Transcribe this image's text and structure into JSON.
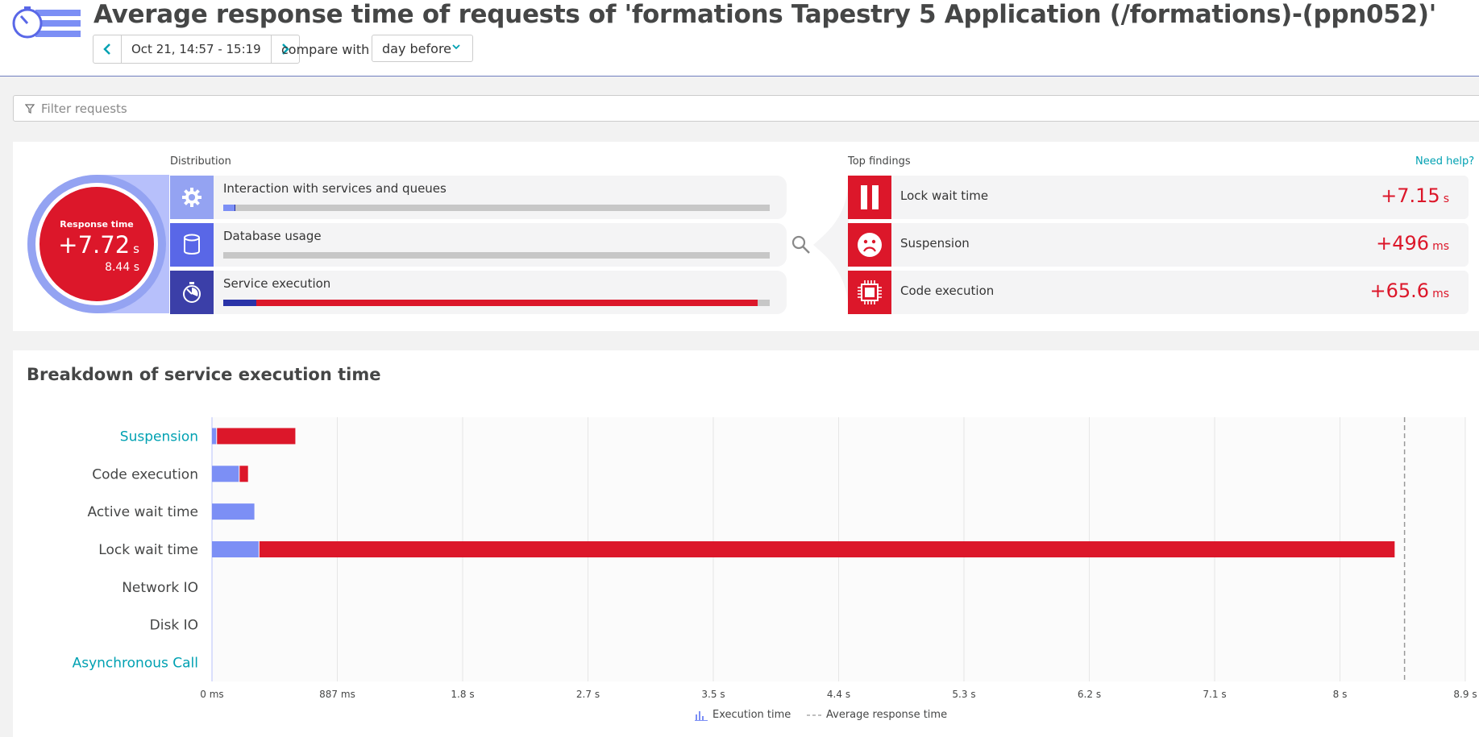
{
  "header": {
    "title": "Average response time of requests of 'formations Tapestry 5 Application (/formations)-(ppn052)'",
    "timeframe": "Oct 21, 14:57 - 15:19",
    "compare_label": "compare with",
    "compare_value": "day before",
    "prev_icon": "chevron-left-icon",
    "next_icon": "chevron-right-icon"
  },
  "filter": {
    "placeholder": "Filter requests",
    "icon": "filter-icon"
  },
  "response_time": {
    "label": "Response time",
    "value": "+7.72",
    "unit": "s",
    "baseline": "8.44",
    "baseline_unit": "s"
  },
  "distribution": {
    "label": "Distribution",
    "rows": [
      {
        "label": "Interaction with services and queues",
        "icon": "gear-icon",
        "icon_bg": "#94a3f2",
        "segments": [
          {
            "color": "#7c8ff5",
            "fraction": 0.02
          },
          {
            "color": "#1f2ba0",
            "fraction": 0.002
          }
        ]
      },
      {
        "label": "Database usage",
        "icon": "database-icon",
        "icon_bg": "#5967e7",
        "segments": []
      },
      {
        "label": "Service execution",
        "icon": "stopwatch-icon",
        "icon_bg": "#3b3fa8",
        "segments": [
          {
            "color": "#2a33a8",
            "fraction": 0.06
          },
          {
            "color": "#dc172a",
            "fraction": 0.918
          }
        ]
      }
    ]
  },
  "findings": {
    "label": "Top findings",
    "help": "Need help?",
    "rows": [
      {
        "label": "Lock wait time",
        "value": "+7.15",
        "unit": "s",
        "icon": "pause-icon"
      },
      {
        "label": "Suspension",
        "value": "+496",
        "unit": "ms",
        "icon": "sad-face-icon"
      },
      {
        "label": "Code execution",
        "value": "+65.6",
        "unit": "ms",
        "icon": "cpu-chip-icon"
      }
    ]
  },
  "breakdown": {
    "title": "Breakdown of service execution time"
  },
  "colors": {
    "execution": "#7c8ff5",
    "increase": "#dc172a",
    "link": "#00a1b2"
  },
  "chart_data": {
    "type": "bar",
    "orientation": "horizontal",
    "stacked": true,
    "categories": [
      "Suspension",
      "Code execution",
      "Active wait time",
      "Lock wait time",
      "Network IO",
      "Disk IO",
      "Asynchronous Call"
    ],
    "category_links": [
      true,
      false,
      false,
      false,
      false,
      false,
      true
    ],
    "series": [
      {
        "name": "Execution time",
        "color": "#7c8ff5",
        "values_ms": [
          30,
          190,
          300,
          330,
          0,
          0,
          0
        ]
      },
      {
        "color": "#dc172a",
        "values_ms": [
          560,
          65,
          0,
          8040,
          0,
          0,
          0
        ]
      }
    ],
    "average_response_time_ms": 8440,
    "x_ticks": [
      "0 ms",
      "887 ms",
      "1.8 s",
      "2.7 s",
      "3.5 s",
      "4.4 s",
      "5.3 s",
      "6.2 s",
      "7.1 s",
      "8 s",
      "8.9 s"
    ],
    "xlim_ms": [
      0,
      8870
    ],
    "legend": {
      "placement": "bottom",
      "items": [
        "Execution time",
        "Average response time"
      ]
    },
    "grid": true
  }
}
